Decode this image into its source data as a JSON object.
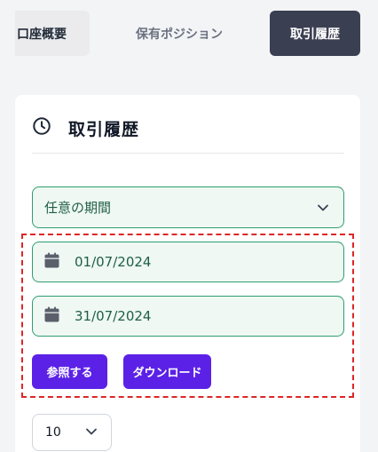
{
  "tabs": {
    "account": "口座概要",
    "positions": "保有ポジション",
    "history": "取引履歴"
  },
  "card": {
    "title": "取引履歴",
    "icon": "clock-icon"
  },
  "filters": {
    "period_value": "任意の期間",
    "date_from": "01/07/2024",
    "date_to": "31/07/2024",
    "refer_label": "参照する",
    "download_label": "ダウンロード"
  },
  "page_size": {
    "value": "10"
  },
  "colors": {
    "active_tab": "#3b3f52",
    "accent": "#5b21e6",
    "field_border": "#2f9e6e",
    "field_bg": "#eff8f3",
    "highlight": "#dc2626"
  }
}
